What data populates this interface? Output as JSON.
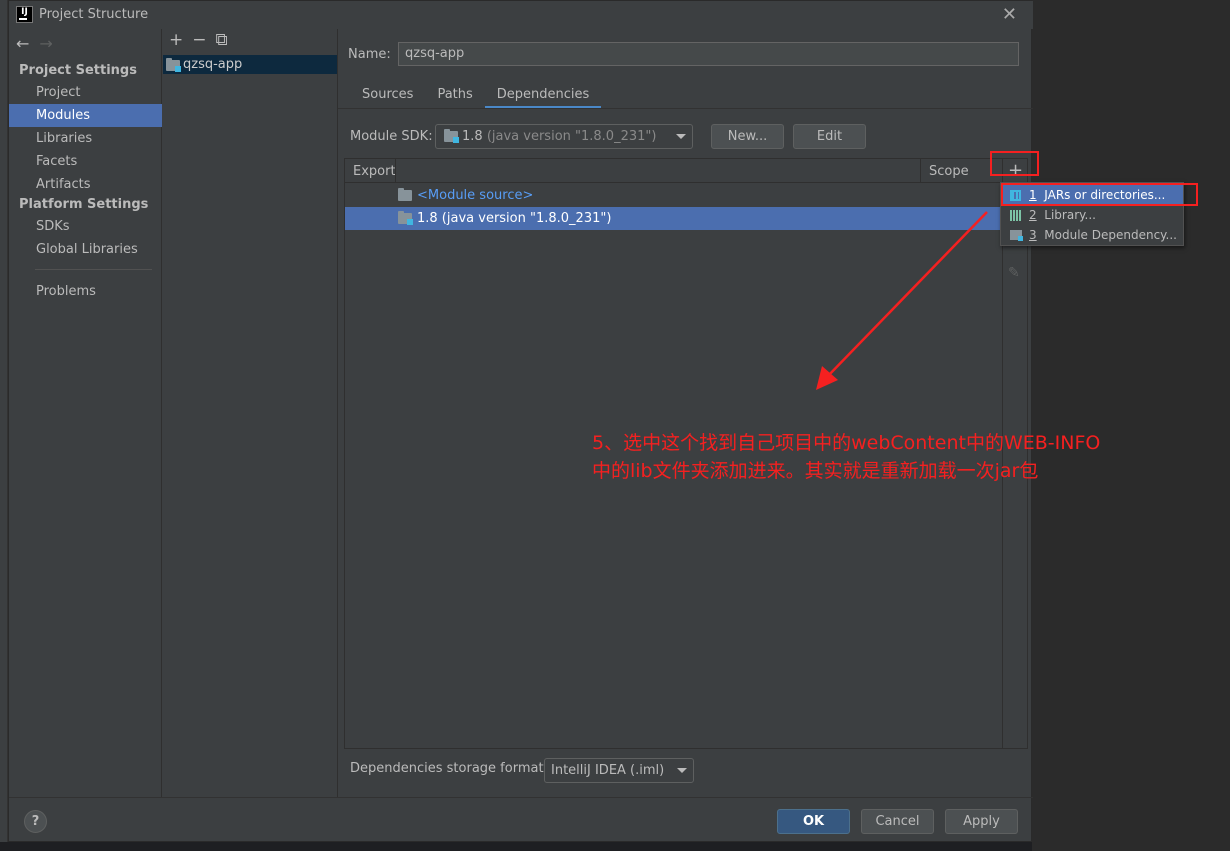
{
  "window": {
    "title": "Project Structure",
    "logo_text": "IJ"
  },
  "nav": {
    "back_icon": "arrow-left-icon",
    "forward_icon": "arrow-right-icon",
    "project_settings_header": "Project Settings",
    "project_settings_items": [
      "Project",
      "Modules",
      "Libraries",
      "Facets",
      "Artifacts"
    ],
    "platform_settings_header": "Platform Settings",
    "platform_settings_items": [
      "SDKs",
      "Global Libraries"
    ],
    "problems": "Problems",
    "selected": "Modules"
  },
  "modules": {
    "toolbar": [
      "+",
      "−",
      "⧉"
    ],
    "items": [
      "qzsq-app"
    ]
  },
  "content": {
    "name_label": "Name:",
    "name_value": "qzsq-app",
    "tabs": [
      "Sources",
      "Paths",
      "Dependencies"
    ],
    "active_tab": "Dependencies",
    "sdk_label": "Module SDK:",
    "sdk_value_main": "1.8",
    "sdk_value_detail": "(java version \"1.8.0_231\")",
    "new_button": "New...",
    "edit_button": "Edit",
    "table": {
      "col_export": "Export",
      "col_scope": "Scope",
      "rows": [
        {
          "label": "<Module source>",
          "selected": false
        },
        {
          "label": "1.8 (java version \"1.8.0_231\")",
          "selected": true
        }
      ]
    },
    "storage_label": "Dependencies storage format:",
    "storage_value": "IntelliJ IDEA (.iml)"
  },
  "popup": {
    "items": [
      {
        "num": "1",
        "label": "JARs or directories...",
        "icon": "jar-icon"
      },
      {
        "num": "2",
        "label": "Library...",
        "icon": "library-icon"
      },
      {
        "num": "3",
        "label": "Module Dependency...",
        "icon": "module-icon"
      }
    ]
  },
  "footer": {
    "help": "?",
    "ok": "OK",
    "cancel": "Cancel",
    "apply": "Apply"
  },
  "annotation": {
    "line1": "5、选中这个找到自己项目中的webContent中的WEB-INFO",
    "line2": "中的lib文件夹添加进来。其实就是重新加载一次jar包",
    "color": "#f52020"
  }
}
